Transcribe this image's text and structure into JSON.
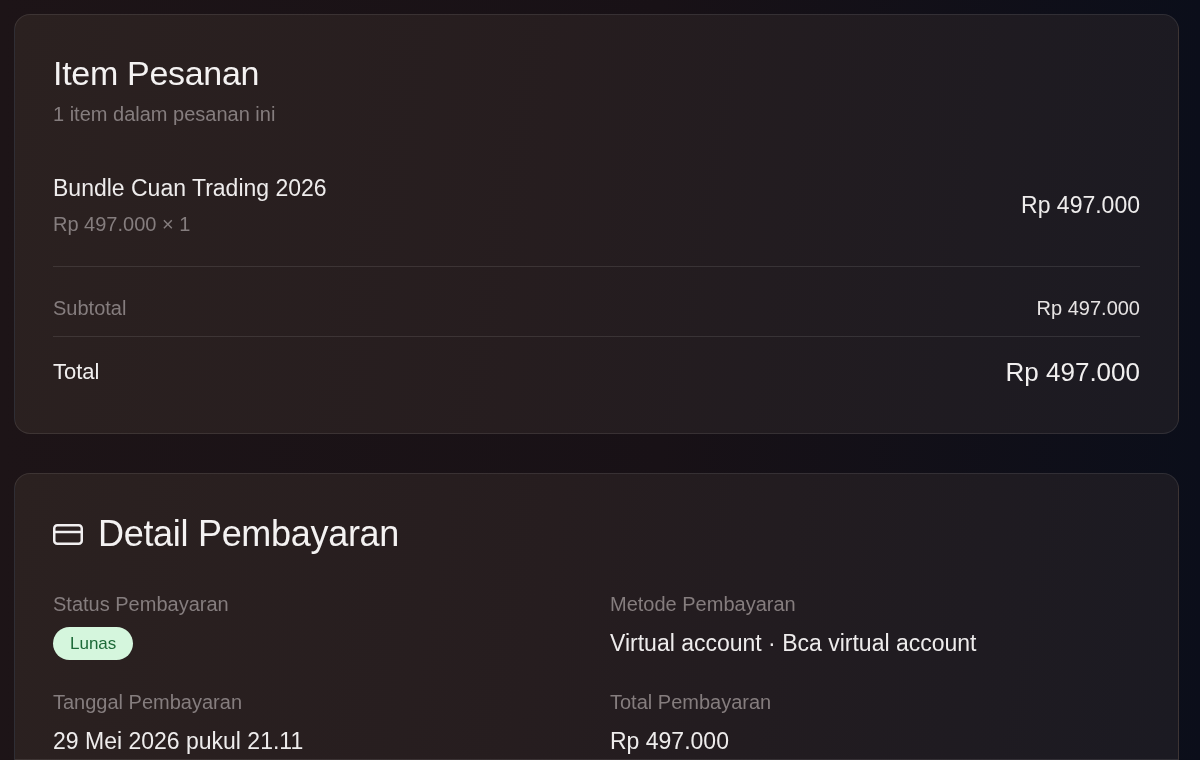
{
  "order_items": {
    "title": "Item Pesanan",
    "subtitle": "1 item dalam pesanan ini",
    "items": [
      {
        "name": "Bundle Cuan Trading 2026",
        "unit_line": "Rp 497.000 × 1",
        "amount": "Rp 497.000"
      }
    ],
    "summary": [
      {
        "kind": "subtotal",
        "label": "Subtotal",
        "value": "Rp 497.000"
      },
      {
        "kind": "total",
        "label": "Total",
        "value": "Rp 497.000"
      }
    ]
  },
  "payment_details": {
    "title": "Detail Pembayaran",
    "fields": [
      {
        "kind": "badge",
        "label": "Status Pembayaran",
        "value": "Lunas"
      },
      {
        "kind": "text",
        "label": "Metode Pembayaran",
        "value": "Virtual account · Bca virtual account"
      },
      {
        "kind": "text",
        "label": "Tanggal Pembayaran",
        "value": "29 Mei 2026 pukul 21.11"
      },
      {
        "kind": "text",
        "label": "Total Pembayaran",
        "value": "Rp 497.000"
      }
    ]
  }
}
